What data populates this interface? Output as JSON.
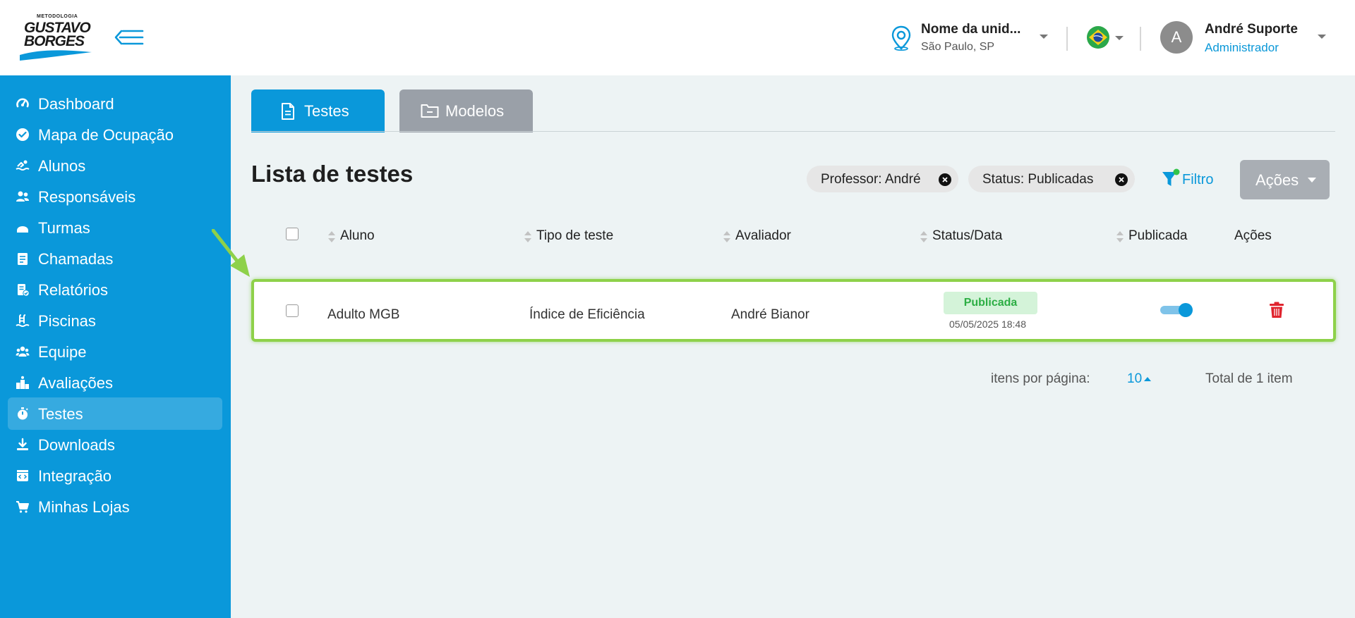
{
  "header": {
    "logo": {
      "top_text": "METODOLOGIA",
      "line1": "GUSTAVO",
      "line2": "BORGES"
    },
    "unit": {
      "name": "Nome da unid...",
      "city": "São Paulo, SP"
    },
    "user": {
      "initial": "A",
      "name": "André Suporte",
      "role": "Administrador"
    },
    "icons": [
      "menu-collapse-icon",
      "location-pin-icon",
      "brazil-flag-icon",
      "chevron-down-icon"
    ]
  },
  "sidebar": {
    "items": [
      {
        "label": "Dashboard",
        "icon": "gauge-icon"
      },
      {
        "label": "Mapa de Ocupação",
        "icon": "check-circle-icon"
      },
      {
        "label": "Alunos",
        "icon": "swimmer-icon"
      },
      {
        "label": "Responsáveis",
        "icon": "users-icon"
      },
      {
        "label": "Turmas",
        "icon": "swim-cap-icon"
      },
      {
        "label": "Chamadas",
        "icon": "clipboard-icon"
      },
      {
        "label": "Relatórios",
        "icon": "report-icon"
      },
      {
        "label": "Piscinas",
        "icon": "pool-ladder-icon"
      },
      {
        "label": "Equipe",
        "icon": "team-icon"
      },
      {
        "label": "Avaliações",
        "icon": "podium-icon"
      },
      {
        "label": "Testes",
        "icon": "stopwatch-icon",
        "active": true
      },
      {
        "label": "Downloads",
        "icon": "download-icon"
      },
      {
        "label": "Integração",
        "icon": "code-window-icon"
      },
      {
        "label": "Minhas Lojas",
        "icon": "cart-icon"
      }
    ]
  },
  "tabs": [
    {
      "label": "Testes",
      "active": true
    },
    {
      "label": "Modelos",
      "active": false
    }
  ],
  "main": {
    "title": "Lista de testes",
    "filters": [
      {
        "label": "Professor: André"
      },
      {
        "label": "Status: Publicadas"
      }
    ],
    "filter_button": "Filtro",
    "actions_button": "Ações"
  },
  "table": {
    "columns": [
      "Aluno",
      "Tipo de teste",
      "Avaliador",
      "Status/Data",
      "Publicada",
      "Ações"
    ],
    "rows": [
      {
        "aluno": "Adulto MGB",
        "tipo": "Índice de Eficiência",
        "avaliador": "André Bianor",
        "status": "Publicada",
        "data": "05/05/2025 18:48",
        "publicada": true
      }
    ]
  },
  "pagination": {
    "per_page_label": "itens por página:",
    "per_page_value": "10",
    "total_label": "Total de 1 item"
  },
  "colors": {
    "primary": "#0a98da",
    "row_highlight": "#8ed14a",
    "status_green": "#2cae44",
    "delete_red": "#e0242e"
  }
}
